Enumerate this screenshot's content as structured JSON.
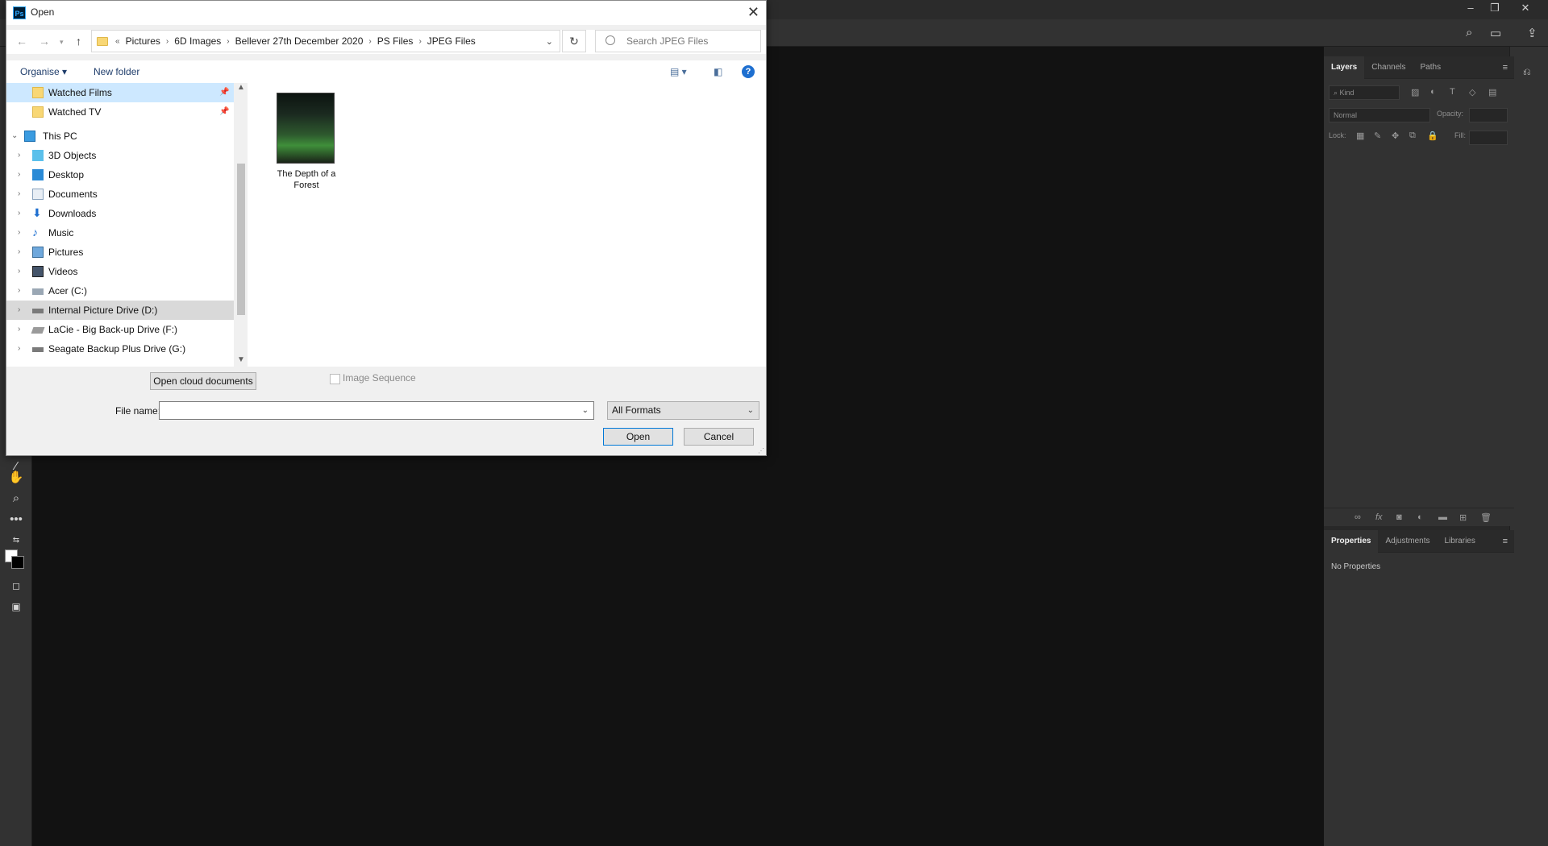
{
  "dialog": {
    "title": "Open",
    "app_badge": "Ps",
    "breadcrumbs": [
      "Pictures",
      "6D Images",
      "Bellever 27th December 2020",
      "PS Files",
      "JPEG Files"
    ],
    "search_placeholder": "Search JPEG Files",
    "toolbar": {
      "organise": "Organise ▾",
      "new_folder": "New folder"
    },
    "nav_items": [
      {
        "label": "Watched Films",
        "icon": "folder-icon",
        "pinned": true
      },
      {
        "label": "Watched TV",
        "icon": "folder-icon",
        "pinned": true
      },
      {
        "label": "This PC",
        "icon": "computer-icon"
      },
      {
        "label": "3D Objects",
        "icon": "cube-icon"
      },
      {
        "label": "Desktop",
        "icon": "desktop-icon"
      },
      {
        "label": "Documents",
        "icon": "document-icon"
      },
      {
        "label": "Downloads",
        "icon": "download-icon"
      },
      {
        "label": "Music",
        "icon": "music-icon"
      },
      {
        "label": "Pictures",
        "icon": "pictures-icon"
      },
      {
        "label": "Videos",
        "icon": "video-icon"
      },
      {
        "label": "Acer (C:)",
        "icon": "drive-icon"
      },
      {
        "label": "Internal Picture Drive (D:)",
        "icon": "drive-icon"
      },
      {
        "label": "LaCie - Big Back-up Drive (F:)",
        "icon": "drive-icon"
      },
      {
        "label": "Seagate Backup Plus Drive  (G:)",
        "icon": "drive-icon"
      }
    ],
    "files": [
      {
        "name": "The Depth of a Forest"
      }
    ],
    "open_cloud": "Open cloud documents",
    "image_sequence": "Image Sequence",
    "file_name_label": "File name:",
    "file_name_value": "",
    "format": "All Formats",
    "open_button": "Open",
    "cancel_button": "Cancel"
  },
  "layers_panel": {
    "tabs": [
      "Layers",
      "Channels",
      "Paths"
    ],
    "kind": "Kind",
    "blend_mode": "Normal",
    "opacity_label": "Opacity:",
    "lock_label": "Lock:",
    "fill_label": "Fill:"
  },
  "properties_panel": {
    "tabs": [
      "Properties",
      "Adjustments",
      "Libraries"
    ],
    "empty_text": "No Properties"
  },
  "colors": {
    "dialog_bg": "#f0f0f0",
    "ps_bg": "#121212",
    "panel_bg": "#323232",
    "selection": "#cde8ff"
  }
}
